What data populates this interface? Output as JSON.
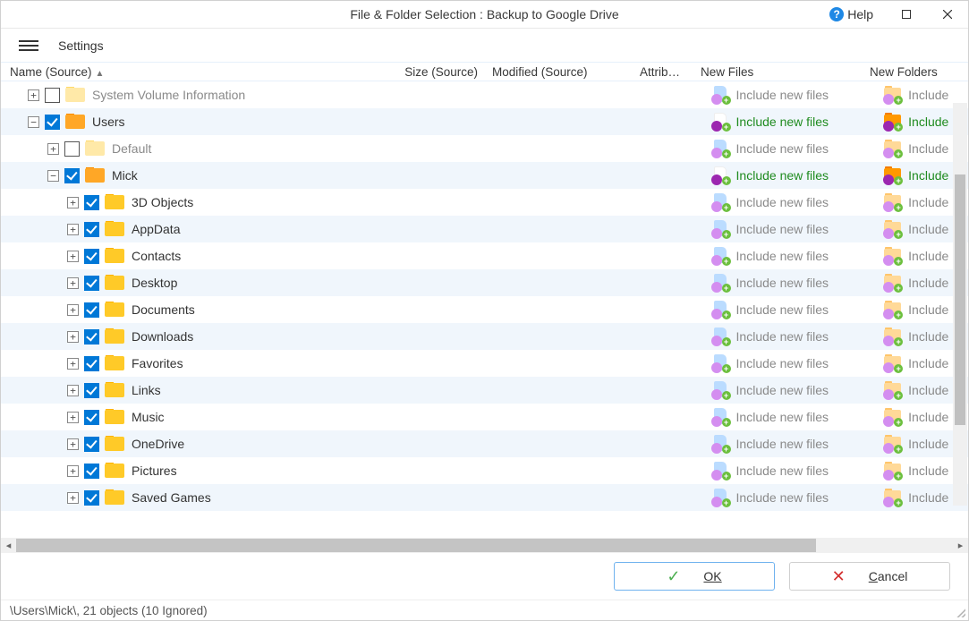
{
  "titlebar": {
    "title": "File & Folder Selection : Backup to Google Drive",
    "help": "Help"
  },
  "menubar": {
    "settings": "Settings"
  },
  "columns": {
    "name": "Name (Source)",
    "size": "Size (Source)",
    "modified": "Modified (Source)",
    "attrib": "Attrib…",
    "newfiles": "New Files",
    "newfolders": "New Folders"
  },
  "rows": [
    {
      "depth": 0,
      "expander": "plus",
      "checked": false,
      "folder": "pale",
      "label": "System Volume Information",
      "muted": true,
      "nf": "muted",
      "expandable": true
    },
    {
      "depth": 0,
      "expander": "minus",
      "checked": true,
      "folder": "orange",
      "label": "Users",
      "muted": false,
      "nf": "active",
      "expandable": true
    },
    {
      "depth": 1,
      "expander": "plus",
      "checked": false,
      "folder": "pale",
      "label": "Default",
      "muted": true,
      "nf": "muted",
      "expandable": true
    },
    {
      "depth": 1,
      "expander": "minus",
      "checked": true,
      "folder": "orange",
      "label": "Mick",
      "muted": false,
      "nf": "active",
      "expandable": true
    },
    {
      "depth": 2,
      "expander": "plus",
      "checked": true,
      "folder": "yellow",
      "label": "3D Objects",
      "muted": false,
      "nf": "muted",
      "expandable": true
    },
    {
      "depth": 2,
      "expander": "plus",
      "checked": true,
      "folder": "yellow",
      "label": "AppData",
      "muted": false,
      "nf": "muted",
      "expandable": true
    },
    {
      "depth": 2,
      "expander": "plus",
      "checked": true,
      "folder": "yellow",
      "label": "Contacts",
      "muted": false,
      "nf": "muted",
      "expandable": true
    },
    {
      "depth": 2,
      "expander": "plus",
      "checked": true,
      "folder": "yellow",
      "label": "Desktop",
      "muted": false,
      "nf": "muted",
      "expandable": true
    },
    {
      "depth": 2,
      "expander": "plus",
      "checked": true,
      "folder": "yellow",
      "label": "Documents",
      "muted": false,
      "nf": "muted",
      "expandable": true
    },
    {
      "depth": 2,
      "expander": "plus",
      "checked": true,
      "folder": "yellow",
      "label": "Downloads",
      "muted": false,
      "nf": "muted",
      "expandable": true
    },
    {
      "depth": 2,
      "expander": "plus",
      "checked": true,
      "folder": "yellow",
      "label": "Favorites",
      "muted": false,
      "nf": "muted",
      "expandable": true
    },
    {
      "depth": 2,
      "expander": "plus",
      "checked": true,
      "folder": "yellow",
      "label": "Links",
      "muted": false,
      "nf": "muted",
      "expandable": true
    },
    {
      "depth": 2,
      "expander": "plus",
      "checked": true,
      "folder": "yellow",
      "label": "Music",
      "muted": false,
      "nf": "muted",
      "expandable": true
    },
    {
      "depth": 2,
      "expander": "plus",
      "checked": true,
      "folder": "yellow",
      "label": "OneDrive",
      "muted": false,
      "nf": "muted",
      "expandable": true
    },
    {
      "depth": 2,
      "expander": "plus",
      "checked": true,
      "folder": "yellow",
      "label": "Pictures",
      "muted": false,
      "nf": "muted",
      "expandable": true
    },
    {
      "depth": 2,
      "expander": "plus",
      "checked": true,
      "folder": "yellow",
      "label": "Saved Games",
      "muted": false,
      "nf": "muted",
      "expandable": true
    }
  ],
  "newfiles_text": "Include new files",
  "newfolders_text": "Include",
  "buttons": {
    "ok": "OK",
    "cancel": "Cancel"
  },
  "statusbar": "\\Users\\Mick\\, 21 objects (10 Ignored)"
}
